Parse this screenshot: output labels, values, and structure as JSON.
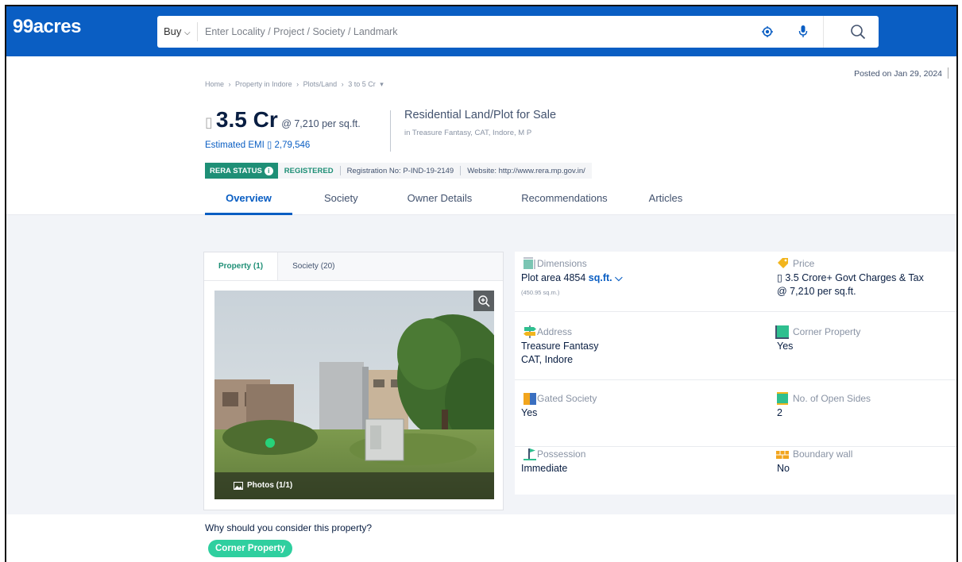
{
  "header": {
    "logo": "99acres",
    "buy_label": "Buy",
    "search_placeholder": "Enter Locality / Project / Society / Landmark"
  },
  "posted": "Posted on Jan 29, 2024",
  "breadcrumb": [
    "Home",
    "›",
    "Property in Indore",
    "›",
    "Plots/Land",
    "›",
    "3 to 5 Cr",
    "▾"
  ],
  "price": {
    "currency_placeholder": "▯",
    "amount": "3.5 Cr",
    "per_unit": "@ 7,210 per sq.ft.",
    "emi": "Estimated EMI ▯ 2,79,546"
  },
  "listing": {
    "title": "Residential Land/Plot for Sale",
    "subtitle": "in Treasure Fantasy, CAT, Indore, M P"
  },
  "rera": {
    "status_label": "RERA STATUS",
    "registered": "REGISTERED",
    "reg_no": "Registration No: P-IND-19-2149",
    "website": "Website: http://www.rera.mp.gov.in/"
  },
  "tabs": [
    "Overview",
    "Society",
    "Owner Details",
    "Recommendations",
    "Articles"
  ],
  "gallery": {
    "tab_property": "Property (1)",
    "tab_society": "Society (20)",
    "photos_label": "Photos (1/1)"
  },
  "details": {
    "dimensions_label": "Dimensions",
    "dimensions_value": "Plot area 4854",
    "dimensions_unit": "sq.ft.",
    "dimensions_sub": "(450.95 sq.m.)",
    "price_label": "Price",
    "price_value": "▯ 3.5 Crore+ Govt Charges & Tax",
    "price_sub": "@ 7,210 per sq.ft.",
    "address_label": "Address",
    "address_line1": "Treasure Fantasy",
    "address_line2": "CAT, Indore",
    "corner_label": "Corner Property",
    "corner_value": "Yes",
    "gated_label": "Gated Society",
    "gated_value": "Yes",
    "open_sides_label": "No. of Open Sides",
    "open_sides_value": "2",
    "possession_label": "Possession",
    "possession_value": "Immediate",
    "boundary_label": "Boundary wall",
    "boundary_value": "No"
  },
  "why": {
    "title": "Why should you consider this property?",
    "chip": "Corner Property"
  },
  "colors": {
    "brand_blue": "#0a5ec3",
    "rera_green": "#1e8f76",
    "chip_green": "#2fcf9f"
  }
}
